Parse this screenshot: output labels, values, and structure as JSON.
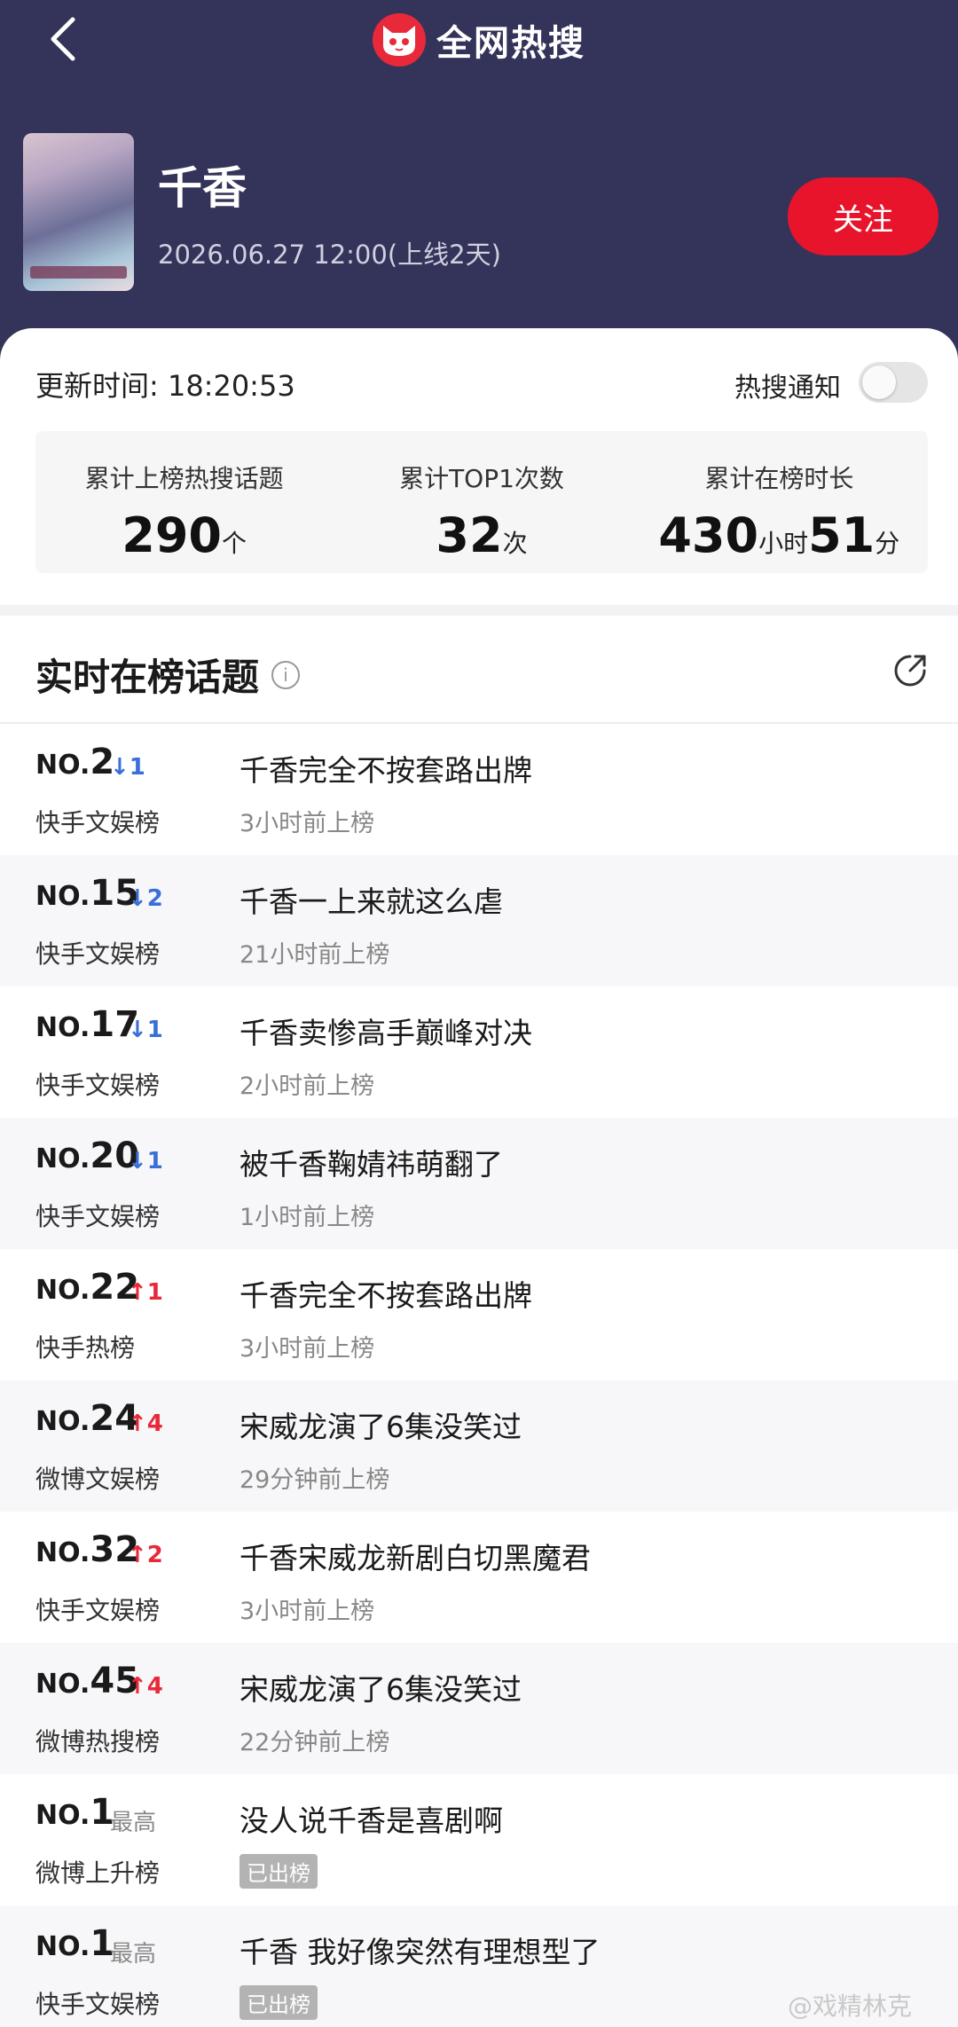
{
  "header": {
    "brand_title": "全网热搜",
    "show_title": "千香",
    "show_date": "2026.06.27 12:00(上线2天)",
    "follow_label": "关注"
  },
  "update": {
    "label": "更新时间: 18:20:53",
    "notify_label": "热搜通知"
  },
  "stats": [
    {
      "label": "累计上榜热搜话题",
      "value": "290",
      "unit": "个"
    },
    {
      "label": "累计TOP1次数",
      "value": "32",
      "unit": "次"
    },
    {
      "label": "累计在榜时长",
      "value1": "430",
      "unit1": "小时",
      "value2": "51",
      "unit2": "分"
    }
  ],
  "section": {
    "title": "实时在榜话题"
  },
  "rows": [
    {
      "no": "NO.",
      "rank": "2",
      "trend": "↓1",
      "trend_type": "down",
      "board": "快手文娱榜",
      "topic": "千香完全不按套路出牌",
      "ago": "3小时前上榜"
    },
    {
      "no": "NO.",
      "rank": "15",
      "trend": "↓2",
      "trend_type": "down",
      "board": "快手文娱榜",
      "topic": "千香一上来就这么虐",
      "ago": "21小时前上榜"
    },
    {
      "no": "NO.",
      "rank": "17",
      "trend": "↓1",
      "trend_type": "down",
      "board": "快手文娱榜",
      "topic": "千香卖惨高手巅峰对决",
      "ago": "2小时前上榜"
    },
    {
      "no": "NO.",
      "rank": "20",
      "trend": "↓1",
      "trend_type": "down",
      "board": "快手文娱榜",
      "topic": "被千香鞠婧祎萌翻了",
      "ago": "1小时前上榜"
    },
    {
      "no": "NO.",
      "rank": "22",
      "trend": "↑1",
      "trend_type": "up",
      "board": "快手热榜",
      "topic": "千香完全不按套路出牌",
      "ago": "3小时前上榜"
    },
    {
      "no": "NO.",
      "rank": "24",
      "trend": "↑4",
      "trend_type": "up",
      "board": "微博文娱榜",
      "topic": "宋威龙演了6集没笑过",
      "ago": "29分钟前上榜"
    },
    {
      "no": "NO.",
      "rank": "32",
      "trend": "↑2",
      "trend_type": "up",
      "board": "快手文娱榜",
      "topic": "千香宋威龙新剧白切黑魔君",
      "ago": "3小时前上榜"
    },
    {
      "no": "NO.",
      "rank": "45",
      "trend": "↑4",
      "trend_type": "up",
      "board": "微博热搜榜",
      "topic": "宋威龙演了6集没笑过",
      "ago": "22分钟前上榜"
    },
    {
      "no": "NO.",
      "rank": "1",
      "trend": "最高",
      "trend_type": "best",
      "board": "微博上升榜",
      "topic": "没人说千香是喜剧啊",
      "ago": "已出榜"
    },
    {
      "no": "NO.",
      "rank": "1",
      "trend": "最高",
      "trend_type": "best",
      "board": "快手文娱榜",
      "topic": "千香 我好像突然有理想型了",
      "ago": "已出榜"
    }
  ],
  "watermark": "@戏精林克"
}
